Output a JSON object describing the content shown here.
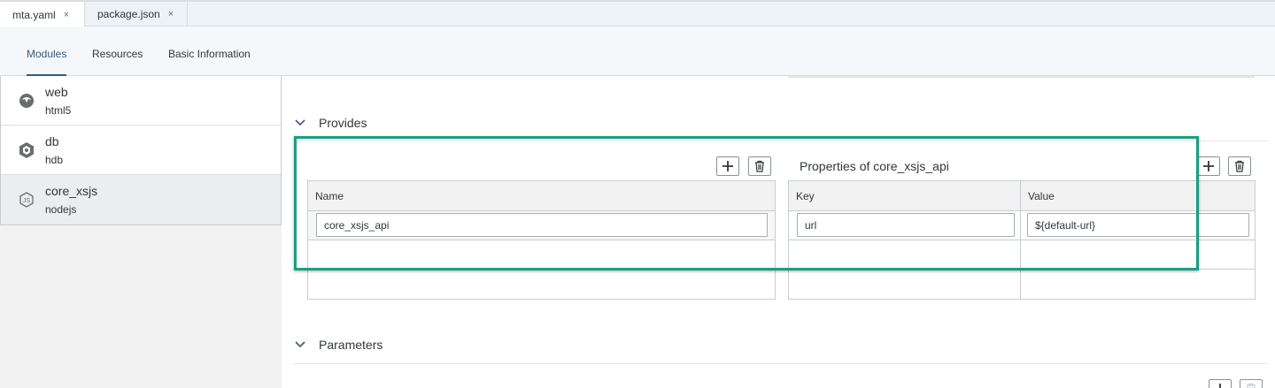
{
  "file_tabs": [
    {
      "label": "mta.yaml",
      "close": "×"
    },
    {
      "label": "package.json",
      "close": "×"
    }
  ],
  "nav_tabs": [
    "Modules",
    "Resources",
    "Basic Information"
  ],
  "modules": [
    {
      "name": "web",
      "type": "html5",
      "icon": "html5-icon"
    },
    {
      "name": "db",
      "type": "hdb",
      "icon": "database-icon"
    },
    {
      "name": "core_xsjs",
      "type": "nodejs",
      "icon": "nodejs-icon"
    }
  ],
  "provides": {
    "title": "Provides",
    "name_header": "Name",
    "name_value": "core_xsjs_api",
    "properties_title": "Properties of core_xsjs_api",
    "key_header": "Key",
    "value_header": "Value",
    "key_value": "url",
    "value_value": "${default-url}"
  },
  "parameters": {
    "title": "Parameters"
  },
  "colors": {
    "highlight": "#1a9e83",
    "accent": "#3a5a7c"
  }
}
